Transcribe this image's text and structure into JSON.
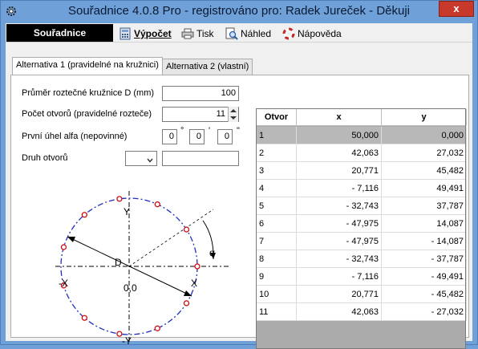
{
  "window": {
    "title": "Souřadnice 4.0.8 Pro - registrováno pro: Radek Jureček - Děkuji",
    "close_label": "x"
  },
  "menu": {
    "title": "Souřadnice",
    "items": [
      {
        "label": "Výpočet",
        "icon": "calculator-icon"
      },
      {
        "label": "Tisk",
        "icon": "printer-icon"
      },
      {
        "label": "Náhled",
        "icon": "preview-icon"
      },
      {
        "label": "Nápověda",
        "icon": "help-icon"
      }
    ]
  },
  "tabs": [
    {
      "label": "Alternativa 1 (pravidelné na kružnici)",
      "active": true
    },
    {
      "label": "Alternativa 2 (vlastní)",
      "active": false
    }
  ],
  "form": {
    "diameter_label": "Průměr roztečné kružnice D (mm)",
    "diameter_value": "100",
    "holes_label": "Počet otvorů (pravidelné rozteče)",
    "holes_value": "11",
    "angle_label": "První úhel alfa (nepovinné)",
    "angle_deg": "0",
    "angle_min": "0",
    "angle_sec": "0",
    "deg_symbol": "°",
    "min_symbol": "'",
    "sec_symbol": "\"",
    "type_label": "Druh otvorů",
    "type_value": "",
    "type_text": ""
  },
  "diagram": {
    "y_top": "Y",
    "y_bottom": "-Y",
    "x_left": "-X",
    "x_right": "X",
    "origin": "0,0",
    "d_label": "D",
    "alpha_label": "α",
    "colors": {
      "circle": "#1f2fbf",
      "holes": "#d01010"
    }
  },
  "table": {
    "headers": [
      "Otvor",
      "x",
      "y"
    ],
    "rows": [
      [
        "1",
        "50,000",
        "0,000"
      ],
      [
        "2",
        "42,063",
        "27,032"
      ],
      [
        "3",
        "20,771",
        "45,482"
      ],
      [
        "4",
        "- 7,116",
        "49,491"
      ],
      [
        "5",
        "- 32,743",
        "37,787"
      ],
      [
        "6",
        "- 47,975",
        "14,087"
      ],
      [
        "7",
        "- 47,975",
        "- 14,087"
      ],
      [
        "8",
        "- 32,743",
        "- 37,787"
      ],
      [
        "9",
        "- 7,116",
        "- 49,491"
      ],
      [
        "10",
        "20,771",
        "- 45,482"
      ],
      [
        "11",
        "42,063",
        "- 27,032"
      ]
    ],
    "selected_row": 0
  }
}
